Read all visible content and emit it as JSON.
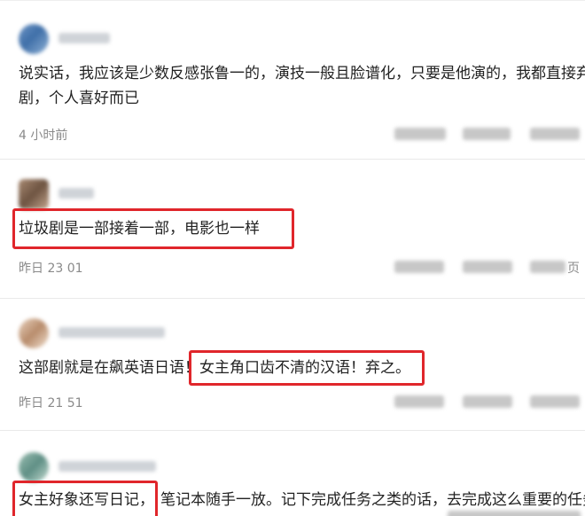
{
  "comments": [
    {
      "line1": "说实话，我应该是少数反感张鲁一的，演技一般且脸谱化，只要是他演的，我都直接弃",
      "line2": "剧，个人喜好而已",
      "time": "4 小时前"
    },
    {
      "text": "垃圾剧是一部接着一部，电影也一样",
      "time": "昨日 23 01",
      "action_suffix": "页"
    },
    {
      "text_part1": "这部剧就是在飙英语日语！",
      "text_part2": "女主角口齿不清的汉语！弃之。",
      "time": "昨日 21 51"
    },
    {
      "text_part1": "女主好象还写日记，",
      "text_part2": "笔记本随手一放。记下完成任务之类的话，去完成这么重要的任务"
    }
  ],
  "colors": {
    "highlight": "#e0262b",
    "text": "#222222",
    "meta": "#8a8a8a"
  }
}
